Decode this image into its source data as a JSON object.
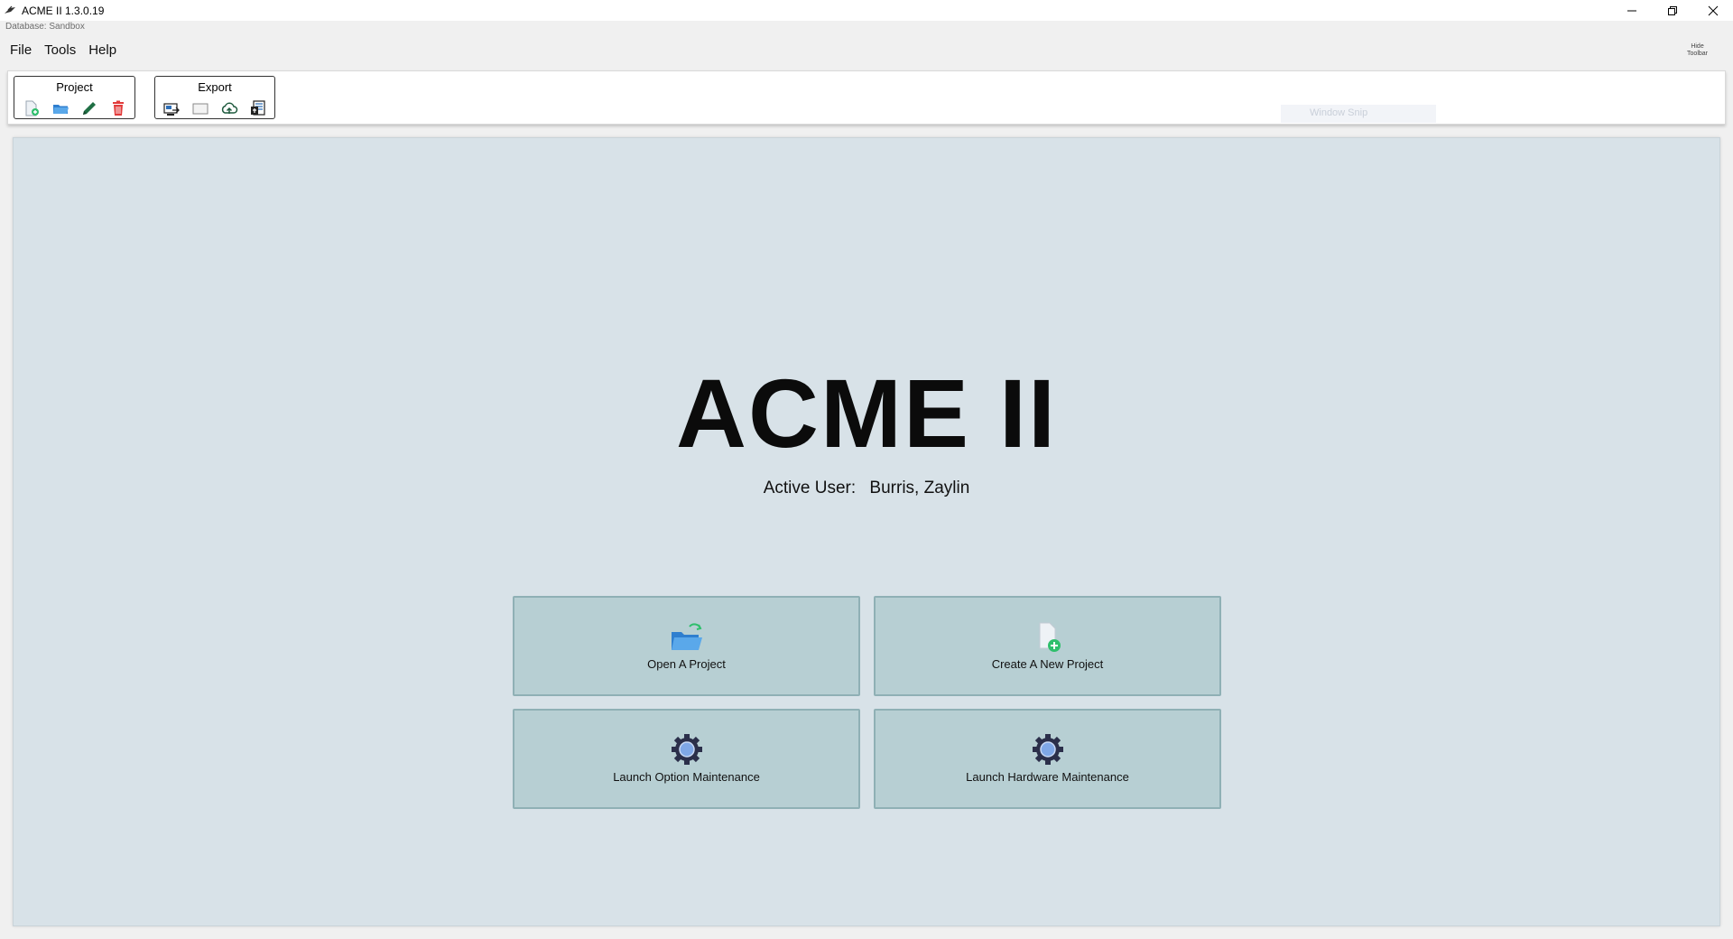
{
  "window": {
    "title": "ACME II 1.3.0.19",
    "database_line": "Database: Sandbox"
  },
  "menu": {
    "items": [
      "File",
      "Tools",
      "Help"
    ]
  },
  "toolbar": {
    "hide_label_line1": "Hide",
    "hide_label_line2": "Toolbar",
    "groups": [
      {
        "title": "Project",
        "icons": [
          "new-project-icon",
          "open-folder-icon",
          "edit-pencil-icon",
          "delete-trash-icon"
        ]
      },
      {
        "title": "Export",
        "icons": [
          "export-report-icon",
          "export-blank-icon",
          "cloud-upload-icon",
          "export-document-icon"
        ]
      }
    ],
    "ghost_text": "Window Snip"
  },
  "main": {
    "app_name": "ACME II",
    "active_user_label": "Active User:",
    "active_user_name": "Burris, Zaylin",
    "tiles": [
      {
        "label": "Open A Project",
        "icon": "open-folder-icon"
      },
      {
        "label": "Create A New Project",
        "icon": "new-file-icon"
      },
      {
        "label": "Launch Option Maintenance",
        "icon": "gear-search-icon"
      },
      {
        "label": "Launch Hardware Maintenance",
        "icon": "gear-search-icon"
      }
    ]
  },
  "colors": {
    "panel_bg": "#d8e2e8",
    "tile_bg": "#b7cfd3",
    "tile_border": "#8fb0b5",
    "delete_red": "#e23b3b",
    "accent_blue": "#3c8fd8",
    "accent_green": "#2fbf6c"
  }
}
